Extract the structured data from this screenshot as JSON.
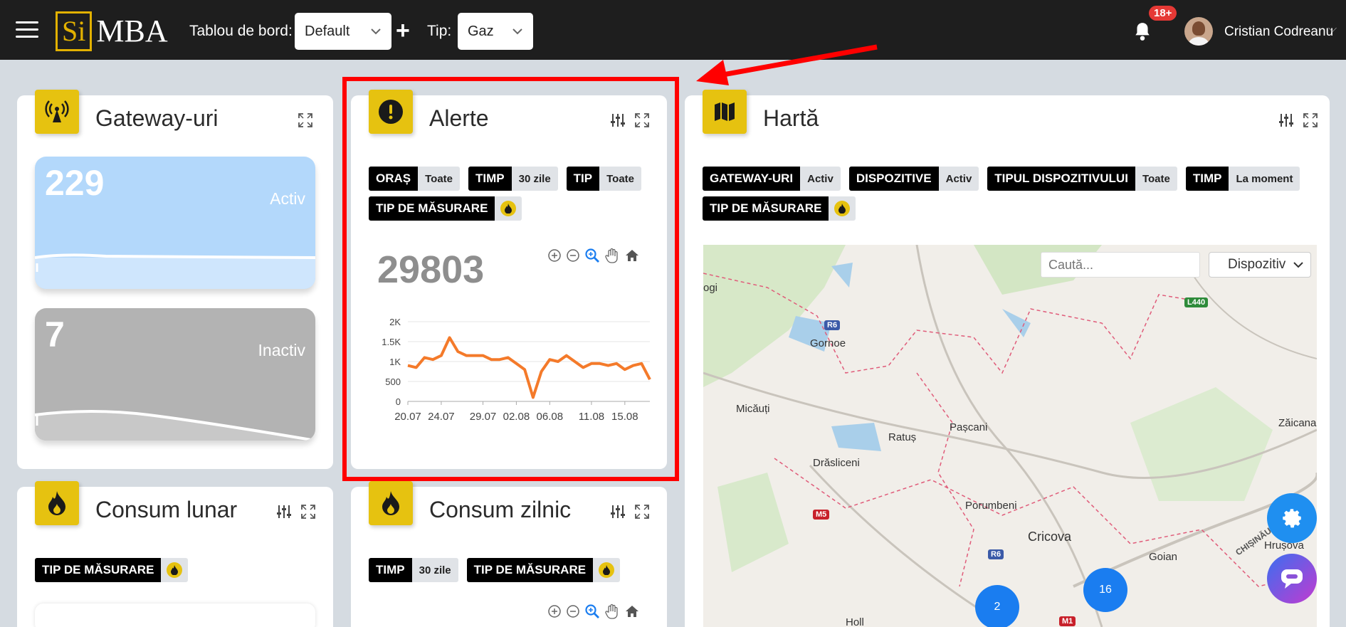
{
  "header": {
    "logo_si": "Si",
    "logo_rest": "MBA",
    "dashboard_label": "Tablou de bord:",
    "dashboard_value": "Default",
    "type_label": "Tip:",
    "type_value": "Gaz",
    "add_label": "+",
    "notif_count": "18+",
    "user_name": "Cristian Codreanu"
  },
  "gateways": {
    "title": "Gateway-uri",
    "active_count": "229",
    "active_label": "Activ",
    "inactive_count": "7",
    "inactive_label": "Inactiv"
  },
  "alerts": {
    "title": "Alerte",
    "chips": [
      {
        "key": "ORAȘ",
        "value": "Toate"
      },
      {
        "key": "TIMP",
        "value": "30 zile"
      },
      {
        "key": "TIP",
        "value": "Toate"
      },
      {
        "key": "TIP DE MĂSURARE",
        "value": ""
      }
    ],
    "total": "29803"
  },
  "chart_data": {
    "type": "line",
    "x": [
      "20.07",
      "21.07",
      "22.07",
      "23.07",
      "24.07",
      "25.07",
      "26.07",
      "27.07",
      "28.07",
      "29.07",
      "30.07",
      "31.07",
      "01.08",
      "02.08",
      "03.08",
      "04.08",
      "05.08",
      "06.08",
      "07.08",
      "08.08",
      "09.08",
      "10.08",
      "11.08",
      "12.08",
      "13.08",
      "14.08",
      "15.08",
      "16.08",
      "17.08",
      "18.08"
    ],
    "tick_labels": [
      "20.07",
      "24.07",
      "29.07",
      "02.08",
      "06.08",
      "11.08",
      "15.08"
    ],
    "y_ticks": [
      "0",
      "500",
      "1K",
      "1.5K",
      "2K"
    ],
    "ylim": [
      0,
      2000
    ],
    "series": [
      {
        "color": "#f47a2a",
        "values": [
          900,
          850,
          1100,
          1050,
          1150,
          1600,
          1250,
          1150,
          1150,
          1150,
          1050,
          1050,
          1100,
          950,
          800,
          100,
          750,
          1050,
          1000,
          1150,
          1000,
          850,
          950,
          950,
          900,
          950,
          800,
          900,
          950,
          550
        ]
      }
    ]
  },
  "map_card": {
    "title": "Hartă",
    "chips": [
      {
        "key": "GATEWAY-URI",
        "value": "Activ"
      },
      {
        "key": "DISPOZITIVE",
        "value": "Activ"
      },
      {
        "key": "TIPUL DISPOZITIVULUI",
        "value": "Toate"
      },
      {
        "key": "TIMP",
        "value": "La moment"
      },
      {
        "key": "TIP DE MĂSURARE",
        "value": ""
      }
    ],
    "search_placeholder": "Caută...",
    "filter_value": "Dispozitiv",
    "places": [
      "Gornoe",
      "Micăuți",
      "Ratuș",
      "Pașcani",
      "Drăsliceni",
      "Porumbeni",
      "Cricova",
      "Goian",
      "Zăicana",
      "Hrușova",
      "ogi",
      "CHIȘINĂU",
      "Holl"
    ],
    "roads": [
      "R6",
      "R6",
      "M5",
      "M1",
      "L440"
    ],
    "clusters": [
      "16",
      "2"
    ]
  },
  "monthly": {
    "title": "Consum lunar",
    "chips": [
      {
        "key": "TIP DE MĂSURARE",
        "value": ""
      }
    ]
  },
  "daily": {
    "title": "Consum zilnic",
    "chips": [
      {
        "key": "TIMP",
        "value": "30 zile"
      },
      {
        "key": "TIP DE MĂSURARE",
        "value": ""
      }
    ]
  }
}
